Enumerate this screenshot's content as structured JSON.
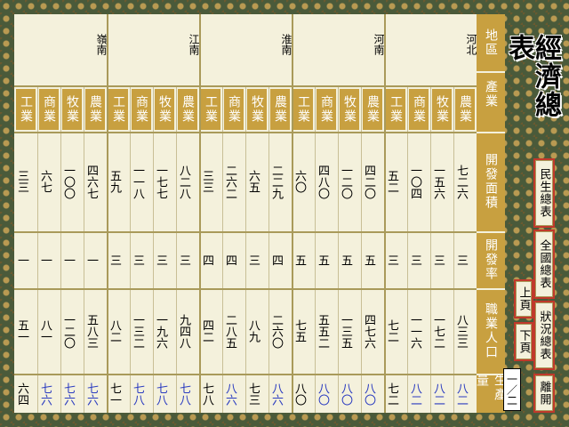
{
  "title": "經濟總表",
  "regions": [
    "嶺南",
    "江南",
    "淮南",
    "河南",
    "河北"
  ],
  "industries": [
    "工業",
    "商業",
    "牧業",
    "農業"
  ],
  "row_labels": [
    "地區",
    "產業",
    "開發面積",
    "開發率",
    "職業人口",
    "生產量"
  ],
  "data": {
    "area": [
      [
        "三三",
        "六七",
        "一〇〇",
        "四六七"
      ],
      [
        "五九",
        "一一八",
        "一七七",
        "八二八"
      ],
      [
        "三三",
        "二六二",
        "六五",
        "二二九"
      ],
      [
        "六〇",
        "四八〇",
        "一二〇",
        "四二〇"
      ],
      [
        "五二",
        "一〇四",
        "一五六",
        "七二六"
      ]
    ],
    "rate": [
      [
        "一",
        "一",
        "一",
        "一"
      ],
      [
        "三",
        "三",
        "三",
        "三"
      ],
      [
        "四",
        "四",
        "三",
        "四"
      ],
      [
        "五",
        "五",
        "五",
        "五"
      ],
      [
        "三",
        "三",
        "三",
        "三"
      ]
    ],
    "population": [
      [
        "五一",
        "八一",
        "一二〇",
        "五八三"
      ],
      [
        "八二",
        "一三二",
        "一九六",
        "九四八"
      ],
      [
        "四二",
        "二八五",
        "八九",
        "二六〇"
      ],
      [
        "七五",
        "五五二",
        "一三五",
        "四七六"
      ],
      [
        "七二",
        "一一六",
        "一七二",
        "八三三"
      ]
    ],
    "production": [
      [
        "六四",
        "七六",
        "七六",
        "七六"
      ],
      [
        "七一",
        "七八",
        "七八",
        "七八"
      ],
      [
        "七八",
        "八六",
        "七三",
        "八六"
      ],
      [
        "八〇",
        "八〇",
        "八〇",
        "八〇"
      ],
      [
        "七二",
        "八二",
        "八二",
        "八二"
      ]
    ],
    "production_blue": [
      [
        false,
        true,
        true,
        true
      ],
      [
        false,
        true,
        true,
        true
      ],
      [
        false,
        true,
        false,
        true
      ],
      [
        false,
        true,
        true,
        true
      ],
      [
        false,
        true,
        true,
        true
      ]
    ]
  },
  "buttons": {
    "people": "民生總表",
    "nation": "全國總表",
    "status": "狀況總表",
    "leave": "離開",
    "prev": "上頁",
    "next": "下頁"
  },
  "page_indicator": "一／二"
}
